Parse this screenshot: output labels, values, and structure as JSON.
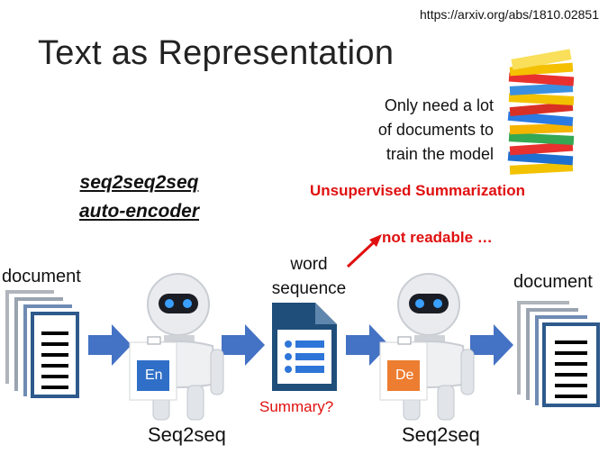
{
  "url": "https://arxiv.org/abs/1810.02851",
  "title": "Text as Representation",
  "note_lines": [
    "Only need a lot",
    "of documents to",
    "train the model"
  ],
  "unsupervised": "Unsupervised Summarization",
  "model_name_lines": [
    "seq2seq2seq",
    "auto-encoder"
  ],
  "not_readable": "not readable …",
  "word_sequence_lines": [
    "word",
    "sequence"
  ],
  "doc_left": "document",
  "doc_right": "document",
  "summary_question": "Summary?",
  "encoder_label": "Seq2seq",
  "decoder_label": "Seq2seq",
  "encoder_badge": "En",
  "decoder_badge": "De",
  "colors": {
    "accent_red": "#e01010",
    "arrow_blue": "#4472c4",
    "doc_blue": "#2e5a8c",
    "encoder_blue": "#2f6fc7",
    "decoder_orange": "#ed7d31"
  }
}
